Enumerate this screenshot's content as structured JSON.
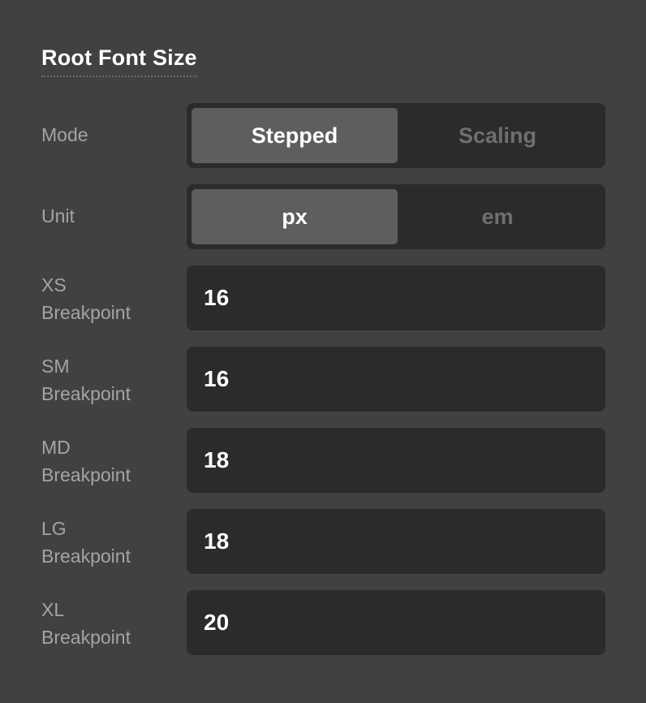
{
  "title": "Root Font Size",
  "mode": {
    "label": "Mode",
    "options": [
      "Stepped",
      "Scaling"
    ],
    "selected": "Stepped"
  },
  "unit": {
    "label": "Unit",
    "options": [
      "px",
      "em"
    ],
    "selected": "px"
  },
  "breakpoints": [
    {
      "size": "XS",
      "suffix": "Breakpoint",
      "value": "16"
    },
    {
      "size": "SM",
      "suffix": "Breakpoint",
      "value": "16"
    },
    {
      "size": "MD",
      "suffix": "Breakpoint",
      "value": "18"
    },
    {
      "size": "LG",
      "suffix": "Breakpoint",
      "value": "18"
    },
    {
      "size": "XL",
      "suffix": "Breakpoint",
      "value": "20"
    }
  ]
}
